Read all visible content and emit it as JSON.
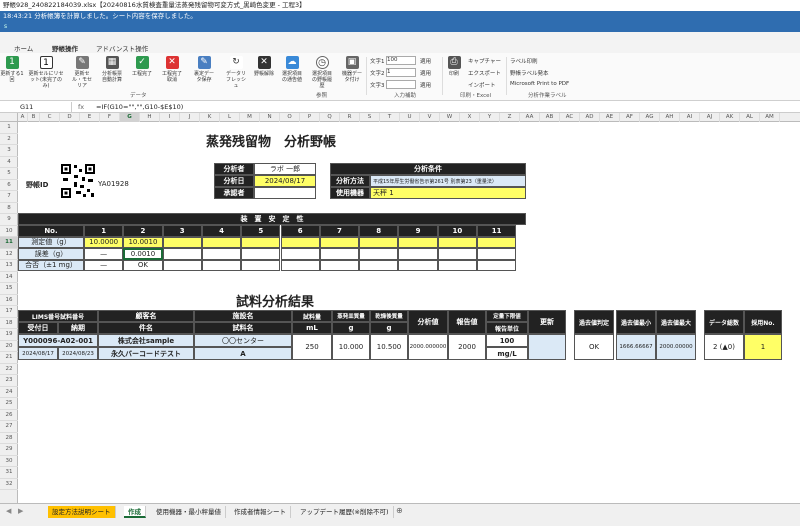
{
  "window": {
    "title": "野帳928_240822184039.xlsx【20240816水質検査重量法蒸発残留物可変方式_黒崎色変更 - 工程3】"
  },
  "status": {
    "message": "18:43:21 分析帳簿を計算しました。シート内容を保存しました。",
    "sub": "s"
  },
  "ribbon": {
    "tabs": [
      "ホーム",
      "野帳操作",
      "アドバンスト操作"
    ],
    "buttons": [
      "更新する1回",
      "更新セルにリセット(未完了のみ)",
      "更新セル・モセリア",
      "分析帳票自動計算",
      "工程完了",
      "工程完了取消",
      "裏定データ保存",
      "データリフレッシュ",
      "野帳解除",
      "選択項目の通告値",
      "選択項目の野帳履歴",
      "機器データ付け",
      "印刷"
    ],
    "text_labels": [
      "文字1",
      "文字2",
      "文字3"
    ],
    "text_values": [
      "100",
      "1",
      ""
    ],
    "apply": "適用",
    "print_items": [
      "キャプチャー",
      "エクスポート",
      "インポート"
    ],
    "label_items": [
      "ラベル印刷",
      "野帳ラベル発本",
      "Microsoft Print to PDF"
    ],
    "groups": [
      "データ",
      "参照",
      "入力補助",
      "印刷・Excel",
      "分析作業ラベル"
    ]
  },
  "formula_bar": {
    "cell": "G11",
    "formula": "=IF(G10=\"\",\"\",G10-$E$10)"
  },
  "columns": [
    "A",
    "B",
    "C",
    "D",
    "E",
    "F",
    "G",
    "H",
    "I",
    "J",
    "K",
    "L",
    "M",
    "N",
    "O",
    "P",
    "Q",
    "R",
    "S",
    "T",
    "U",
    "V",
    "W",
    "X",
    "Y",
    "Z",
    "AA",
    "AB",
    "AC",
    "AD",
    "AE",
    "AF",
    "AG",
    "AH",
    "AI",
    "AJ",
    "AK",
    "AL",
    "AM"
  ],
  "rows": [
    "1",
    "2",
    "3",
    "4",
    "5",
    "6",
    "7",
    "8",
    "9",
    "10",
    "11",
    "12",
    "13",
    "14",
    "15",
    "16",
    "17",
    "18",
    "19",
    "20",
    "21",
    "22",
    "23",
    "24",
    "25",
    "26",
    "27",
    "28",
    "29",
    "30",
    "31",
    "32"
  ],
  "sheet": {
    "title": "蒸発残留物　分析野帳",
    "field_id": "野帳ID",
    "field_id_value": "YA01928",
    "analyst_label": "分析者",
    "analyst": "ラボ 一郎",
    "date_label": "分析日",
    "date": "2024/08/17",
    "approver_label": "承認者",
    "approver": "",
    "cond_header": "分析条件",
    "method_label": "分析方法",
    "method": "平成15年厚生労働省告示第261号 別表第23（重量法）",
    "instrument_label": "使用機器",
    "instrument": "天秤 1",
    "stability_header": "装　置　安　定　性",
    "no_label": "No.",
    "stab_cols": [
      "1",
      "2",
      "3",
      "4",
      "5",
      "6",
      "7",
      "8",
      "9",
      "10",
      "11"
    ],
    "row_measured": "測定値（g）",
    "measured": [
      "10.0000",
      "10.0010"
    ],
    "row_error": "誤差（g）",
    "errors": [
      "—",
      "0.0010"
    ],
    "row_pass": "合否（±1 mg）",
    "pass": [
      "—",
      "OK"
    ],
    "results_header": "試料分析結果",
    "h_lims": "LIMS番号試料番号",
    "h_client": "顧客名",
    "h_facility": "施設名",
    "h_vol": "試料量",
    "h_vol_unit": "mL",
    "h_dish": "蒸発皿質量",
    "h_dish_unit": "g",
    "h_dry": "乾燥後質量",
    "h_dry_unit": "g",
    "h_value": "分析値",
    "h_report": "報告値",
    "h_lower": "定量下限値",
    "h_lower_unit": "報告単位",
    "h_update": "更新",
    "h_received": "受付日",
    "h_due": "納期",
    "h_item": "件名",
    "h_sample": "試料名",
    "lims": "Y000096-A02-001",
    "client": "株式会社sample",
    "facility": "〇〇センター",
    "received": "2024/08/17",
    "due": "2024/08/23",
    "item": "永久バーコードテスト",
    "sample": "A",
    "vol": "250",
    "dish": "10.000",
    "dry": "10.500",
    "value": "2000.000000",
    "report": "2000",
    "lower": "100",
    "unit": "mg/L",
    "h_past_judge": "過去値判定",
    "past_judge": "OK",
    "h_past_min": "過去値最小",
    "past_min": "1666.66667",
    "h_past_max": "過去値最大",
    "past_max": "2000.00000",
    "h_count": "データ総数",
    "count": "2 (▲0)",
    "h_adopt": "採用No.",
    "adopt": "1"
  },
  "sheet_tabs": [
    "設定方法説明シート",
    "作成",
    "使用機器・最小秤量値",
    "作成者情報シート",
    "アップデート履歴(※削除不可)"
  ],
  "colors": {
    "accent": "#1a6b36",
    "status": "#2f6db0",
    "yellow": "#ffff66",
    "lightblue": "#dbe9f6"
  }
}
